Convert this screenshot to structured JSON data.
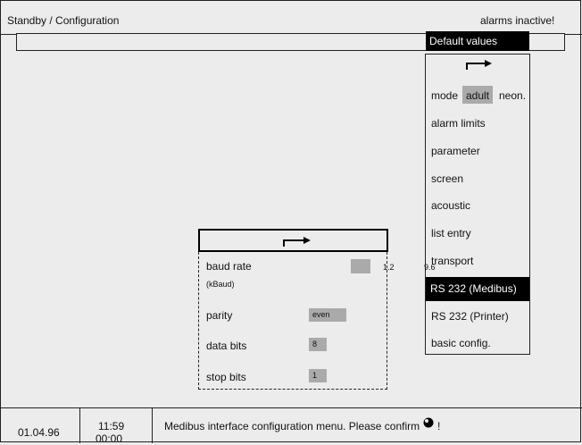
{
  "header": {
    "title": "Standby / Configuration",
    "alarm_status": "alarms inactive!"
  },
  "menu": {
    "title": "Default values",
    "items": [
      "alarm limits",
      "parameter",
      "screen",
      "acoustic",
      "list entry",
      "transport",
      "RS 232 (Medibus)",
      "RS 232 (Printer)",
      "basic config."
    ],
    "mode_label": "mode",
    "mode_options": [
      "adult",
      "neon."
    ],
    "mode_selected": "adult",
    "selected_item": "RS 232 (Medibus)"
  },
  "dialog": {
    "fields": {
      "baud_rate_label": "baud rate",
      "baud_rate_unit": "(kBaud)",
      "baud_rate_options": [
        "1.2",
        "9.6"
      ],
      "parity_label": "parity",
      "parity_value": "even",
      "data_bits_label": "data bits",
      "data_bits_value": "8",
      "stop_bits_label": "stop bits",
      "stop_bits_value": "1"
    }
  },
  "status": {
    "date": "01.04.96",
    "time": "11:59",
    "timer": "00:00",
    "message": "Medibus interface configuration menu. Please confirm",
    "message_suffix": "!"
  },
  "icons": {
    "confirm": "confirm-knob-icon",
    "return": "return-arrow-icon"
  }
}
